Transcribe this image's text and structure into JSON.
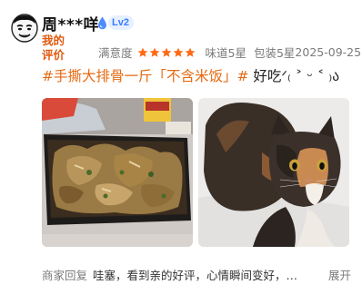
{
  "review": {
    "username": "周***咩",
    "level": "Lv2",
    "my_review_label": "我的评价",
    "satisfaction_label": "满意度",
    "stars": 5,
    "star_color": "#ff6a14",
    "taste_rating": "味道5星",
    "packaging_rating": "包装5星",
    "date": "2025-09-25",
    "hashtag": "#手撕大排骨一斤「不含米饭」#",
    "text": " 好吃ᐟ₍ ˃ ᵕ ˂ ₎ა",
    "photos": [
      "food-photo",
      "cat-photo"
    ]
  },
  "merchant_reply": {
    "label": "商家回复",
    "text": "哇塞，看到亲的好评，心情瞬间变好，…",
    "expand_label": "展开"
  },
  "colors": {
    "accent": "#e66a12",
    "level_badge": "#3a7bff",
    "secondary_text": "#7a7a7a"
  }
}
